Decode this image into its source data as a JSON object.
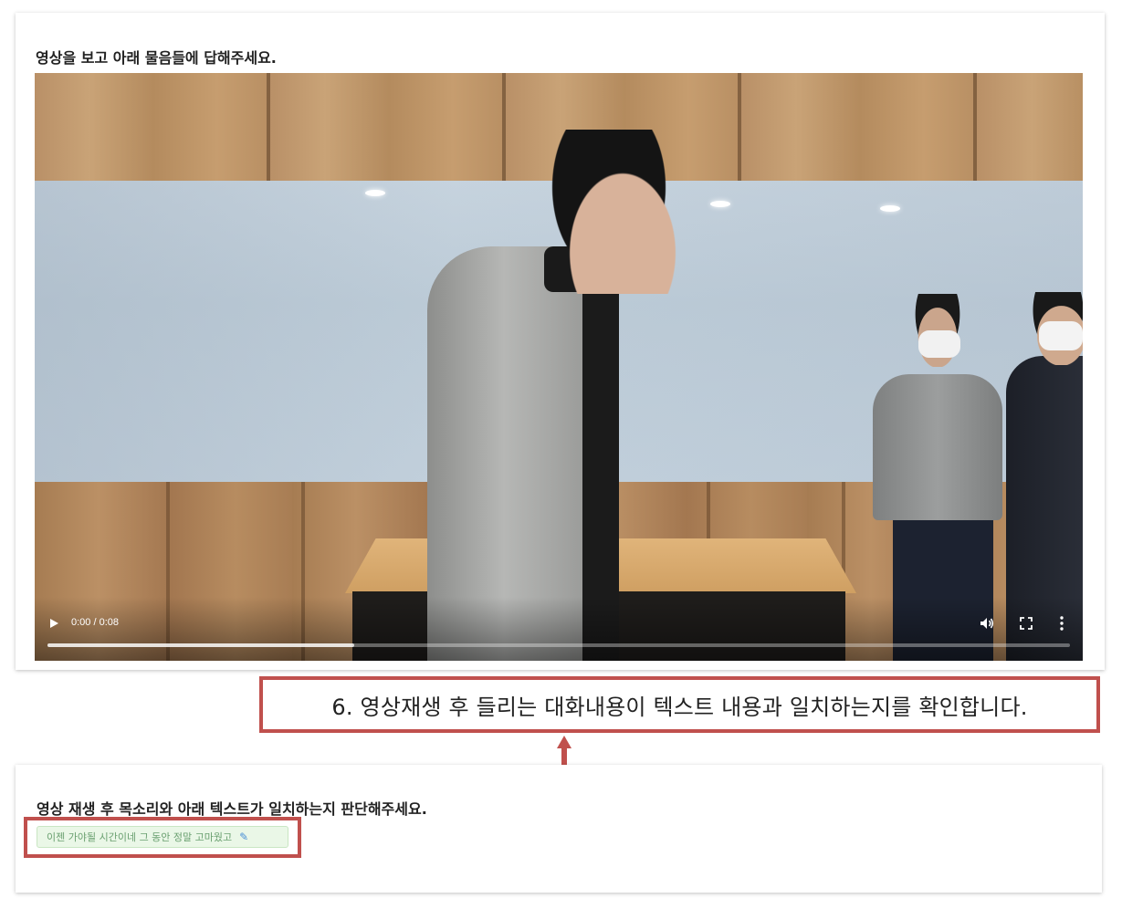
{
  "question1": {
    "title": "영상을 보고 아래 물음들에 답해주세요."
  },
  "video": {
    "time": "0:00 / 0:08",
    "progress_buffered_fraction": 0.3
  },
  "callout": {
    "text": "6. 영상재생 후 들리는 대화내용이 텍스트 내용과 일치하는지를 확인합니다."
  },
  "question2": {
    "title": "영상 재생 후 목소리와 아래 텍스트가 일치하는지 판단해주세요.",
    "transcript": "이젠 가야될 시간이네 그 동안 정말 고마웠고"
  },
  "colors": {
    "highlight": "#c0504d",
    "chip_bg": "#eaf7e7",
    "chip_text": "#6aa070",
    "edit_icon": "#4a8fd6"
  }
}
